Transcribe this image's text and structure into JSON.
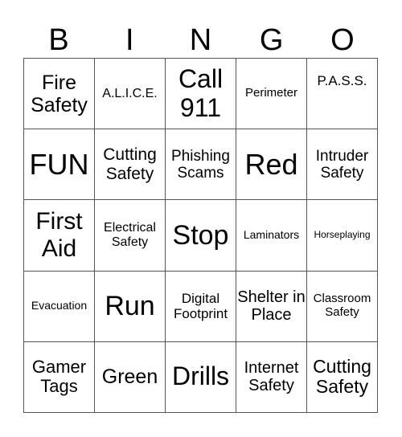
{
  "header": [
    "B",
    "I",
    "N",
    "G",
    "O"
  ],
  "cells": [
    [
      {
        "text": "Fire Safety",
        "size": 25
      },
      {
        "text": "A.L.I.C.E.",
        "size": 16
      },
      {
        "text": "Call 911",
        "size": 32
      },
      {
        "text": "Perimeter",
        "size": 15
      },
      {
        "text": "P.A.S.S.",
        "size": 17,
        "valign": "top"
      }
    ],
    [
      {
        "text": "FUN",
        "size": 36
      },
      {
        "text": "Cutting Safety",
        "size": 21
      },
      {
        "text": "Phishing Scams",
        "size": 19
      },
      {
        "text": "Red",
        "size": 36
      },
      {
        "text": "Intruder Safety",
        "size": 19
      }
    ],
    [
      {
        "text": "First Aid",
        "size": 30
      },
      {
        "text": "Electrical Safety",
        "size": 16
      },
      {
        "text": "Stop",
        "size": 34
      },
      {
        "text": "Laminators",
        "size": 14
      },
      {
        "text": "Horseplaying",
        "size": 12
      }
    ],
    [
      {
        "text": "Evacuation",
        "size": 14
      },
      {
        "text": "Run",
        "size": 34
      },
      {
        "text": "Digital Footprint",
        "size": 17
      },
      {
        "text": "Shelter in Place",
        "size": 20
      },
      {
        "text": "Classroom Safety",
        "size": 15
      }
    ],
    [
      {
        "text": "Gamer Tags",
        "size": 22
      },
      {
        "text": "Green",
        "size": 25
      },
      {
        "text": "Drills",
        "size": 32
      },
      {
        "text": "Internet Safety",
        "size": 20
      },
      {
        "text": "Cutting Safety",
        "size": 23
      }
    ]
  ]
}
